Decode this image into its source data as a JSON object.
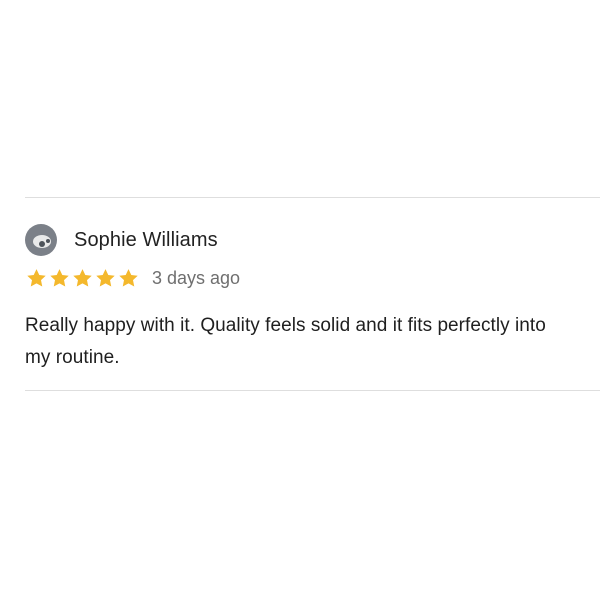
{
  "review": {
    "reviewer_name": "Sophie Williams",
    "rating": 5,
    "rating_max": 5,
    "time_ago": "3 days ago",
    "text": "Really happy with it. Quality feels solid and it fits perfectly into my routine."
  },
  "icons": {
    "avatar": "user-avatar",
    "star": "star-icon"
  },
  "colors": {
    "star": "#f4b82c",
    "divider": "#dedede",
    "text": "#1f1f1f",
    "muted": "#6f6f6f"
  }
}
